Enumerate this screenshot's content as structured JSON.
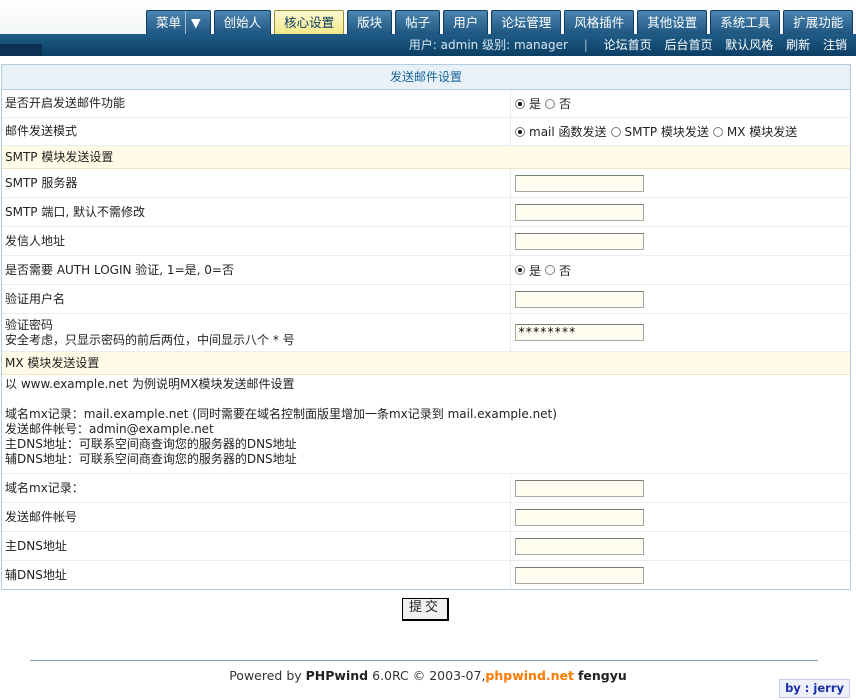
{
  "tabs": [
    {
      "label": "菜单"
    },
    {
      "label": "创始人"
    },
    {
      "label": "核心设置",
      "active": true
    },
    {
      "label": "版块"
    },
    {
      "label": "帖子"
    },
    {
      "label": "用户"
    },
    {
      "label": "论坛管理"
    },
    {
      "label": "风格插件"
    },
    {
      "label": "其他设置"
    },
    {
      "label": "系统工具"
    },
    {
      "label": "扩展功能"
    }
  ],
  "menu_caret": "▼",
  "user": {
    "prefix": "用户:",
    "name": "admin",
    "level_label": "级别:",
    "level": "manager"
  },
  "nav_links": [
    "论坛首页",
    "后台首页",
    "默认风格",
    "刷新",
    "注销"
  ],
  "panel": {
    "title": "发送邮件设置"
  },
  "fields": {
    "enable": {
      "label": "是否开启发送邮件功能",
      "yes": "是",
      "no": "否",
      "selected": "yes"
    },
    "mode": {
      "label": "邮件发送模式",
      "opt1": "mail 函数发送",
      "opt2": "SMTP 模块发送",
      "opt3": "MX 模块发送",
      "selected": "opt1"
    },
    "smtp_section": "SMTP 模块发送设置",
    "smtp_server": {
      "label": "SMTP 服务器",
      "value": ""
    },
    "smtp_port": {
      "label": "SMTP 端口, 默认不需修改",
      "value": ""
    },
    "sender": {
      "label": "发信人地址",
      "value": ""
    },
    "auth": {
      "label": "是否需要 AUTH LOGIN 验证, 1=是, 0=否",
      "yes": "是",
      "no": "否",
      "selected": "yes"
    },
    "auth_user": {
      "label": "验证用户名",
      "value": ""
    },
    "auth_pass": {
      "label": "验证密码",
      "note": "安全考虑，只显示密码的前后两位，中间显示八个 * 号",
      "value": "********"
    },
    "mx_section": "MX 模块发送设置",
    "mx_info": {
      "intro": "以 www.example.net 为例说明MX模块发送邮件设置",
      "line1": "域名mx记录：mail.example.net (同时需要在域名控制面版里增加一条mx记录到 mail.example.net)",
      "line2": "发送邮件帐号：admin@example.net",
      "line3": "主DNS地址：可联系空间商查询您的服务器的DNS地址",
      "line4": "辅DNS地址：可联系空间商查询您的服务器的DNS地址"
    },
    "mx_record": {
      "label": "域名mx记录：",
      "value": ""
    },
    "mx_account": {
      "label": "发送邮件帐号",
      "value": ""
    },
    "dns1": {
      "label": "主DNS地址",
      "value": ""
    },
    "dns2": {
      "label": "辅DNS地址",
      "value": ""
    }
  },
  "submit_label": "提交",
  "footer": {
    "prefix": "Powered by",
    "product": "PHPwind",
    "version": "6.0RC © 2003-07,",
    "site": "phpwind.net",
    "author": "fengyu"
  },
  "byline": "by : jerry"
}
